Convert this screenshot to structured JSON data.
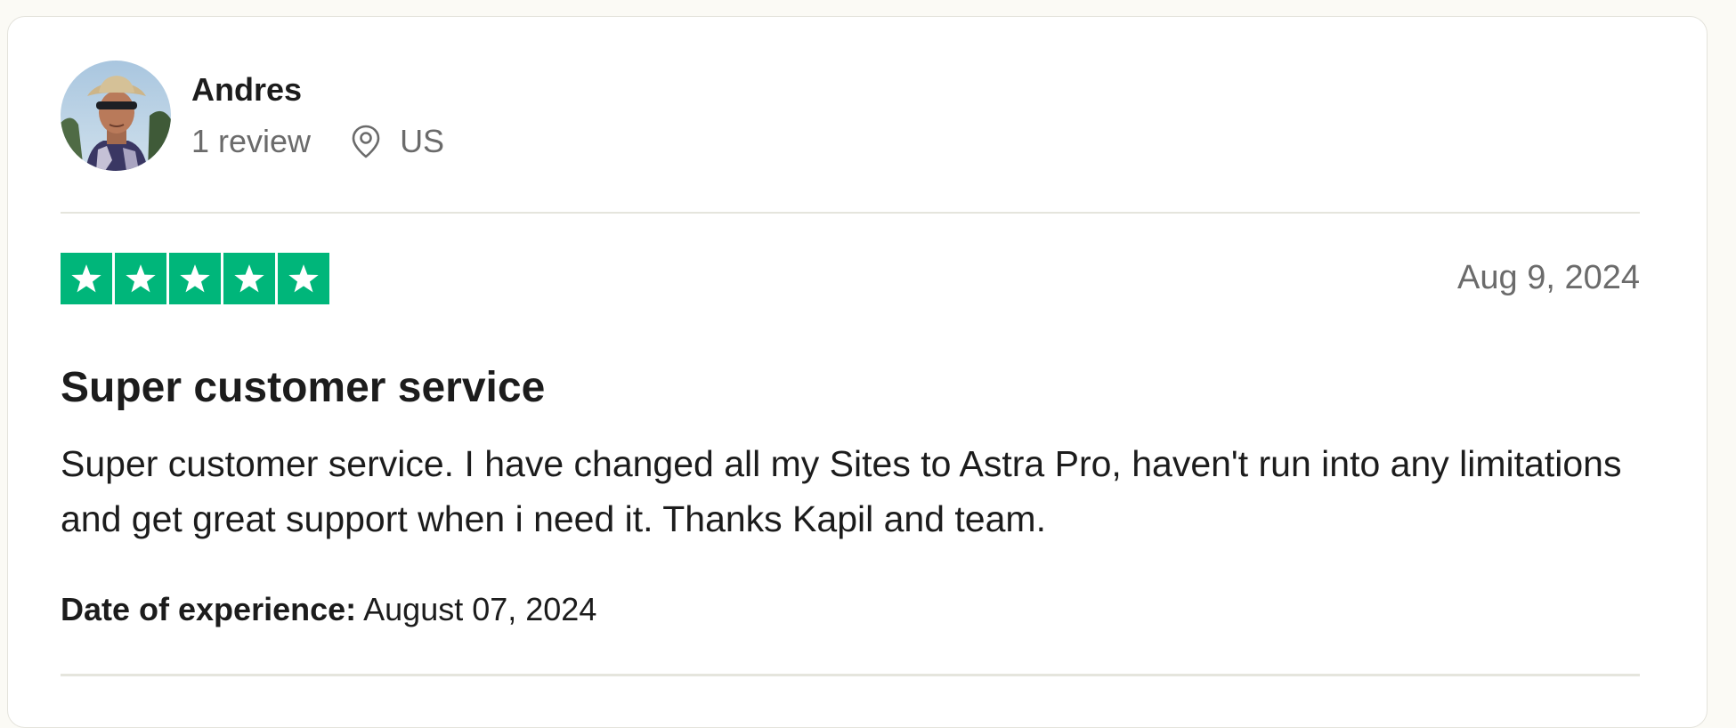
{
  "review": {
    "consumer": {
      "name": "Andres",
      "review_count": "1 review",
      "country": "US",
      "avatar_icon": "profile-photo",
      "location_icon": "location-pin-icon"
    },
    "rating": {
      "stars": 5,
      "max_stars": 5,
      "star_color": "#00b67a"
    },
    "date": "Aug 9, 2024",
    "title": "Super customer service",
    "text": "Super customer service. I have changed all my Sites to Astra Pro, haven't run into any limitations and get great support when i need it. Thanks Kapil and team.",
    "experience": {
      "label": "Date of experience:",
      "value": "August 07, 2024"
    }
  },
  "colors": {
    "page_background": "#fbfaf5",
    "card_background": "#ffffff",
    "divider": "#e5e5dd",
    "muted_text": "#6b6b6b",
    "primary_text": "#1c1c1c"
  }
}
